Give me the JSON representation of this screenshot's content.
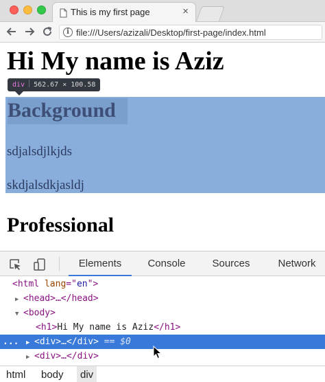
{
  "browser": {
    "tab_title": "This is my first page",
    "tab_close": "×",
    "url": "file:///Users/azizali/Desktop/first-page/index.html",
    "info_glyph": "i"
  },
  "page": {
    "h1": "Hi My name is Aziz",
    "h2_background": "Background",
    "paragraphs": [
      "sdjalsdjlkjds",
      "skdjalsdkjasldj"
    ],
    "h2_professional": "Professional"
  },
  "inspect_tooltip": {
    "tag": "div",
    "dims": "562.67 × 100.58"
  },
  "devtools": {
    "tabs": [
      "Elements",
      "Console",
      "Sources",
      "Network"
    ],
    "active_tab": "Elements",
    "tree": {
      "html_open": "<html ",
      "html_attr": "lang",
      "html_eq": "=\"",
      "html_val": "en",
      "html_close": "\">",
      "head": "<head>…</head>",
      "body": "<body>",
      "h1_open": "<h1>",
      "h1_text": "Hi My name is Aziz",
      "h1_close": "</h1>",
      "div_selected": "<div>…</div>",
      "selected_marker": " == $0",
      "selected_dots": "...",
      "div_next": "<div>…</div>"
    },
    "breadcrumbs": [
      "html",
      "body",
      "div"
    ]
  },
  "colors": {
    "highlight": "#8aaedc",
    "selection": "#3879d9",
    "tag_color": "#881280"
  }
}
